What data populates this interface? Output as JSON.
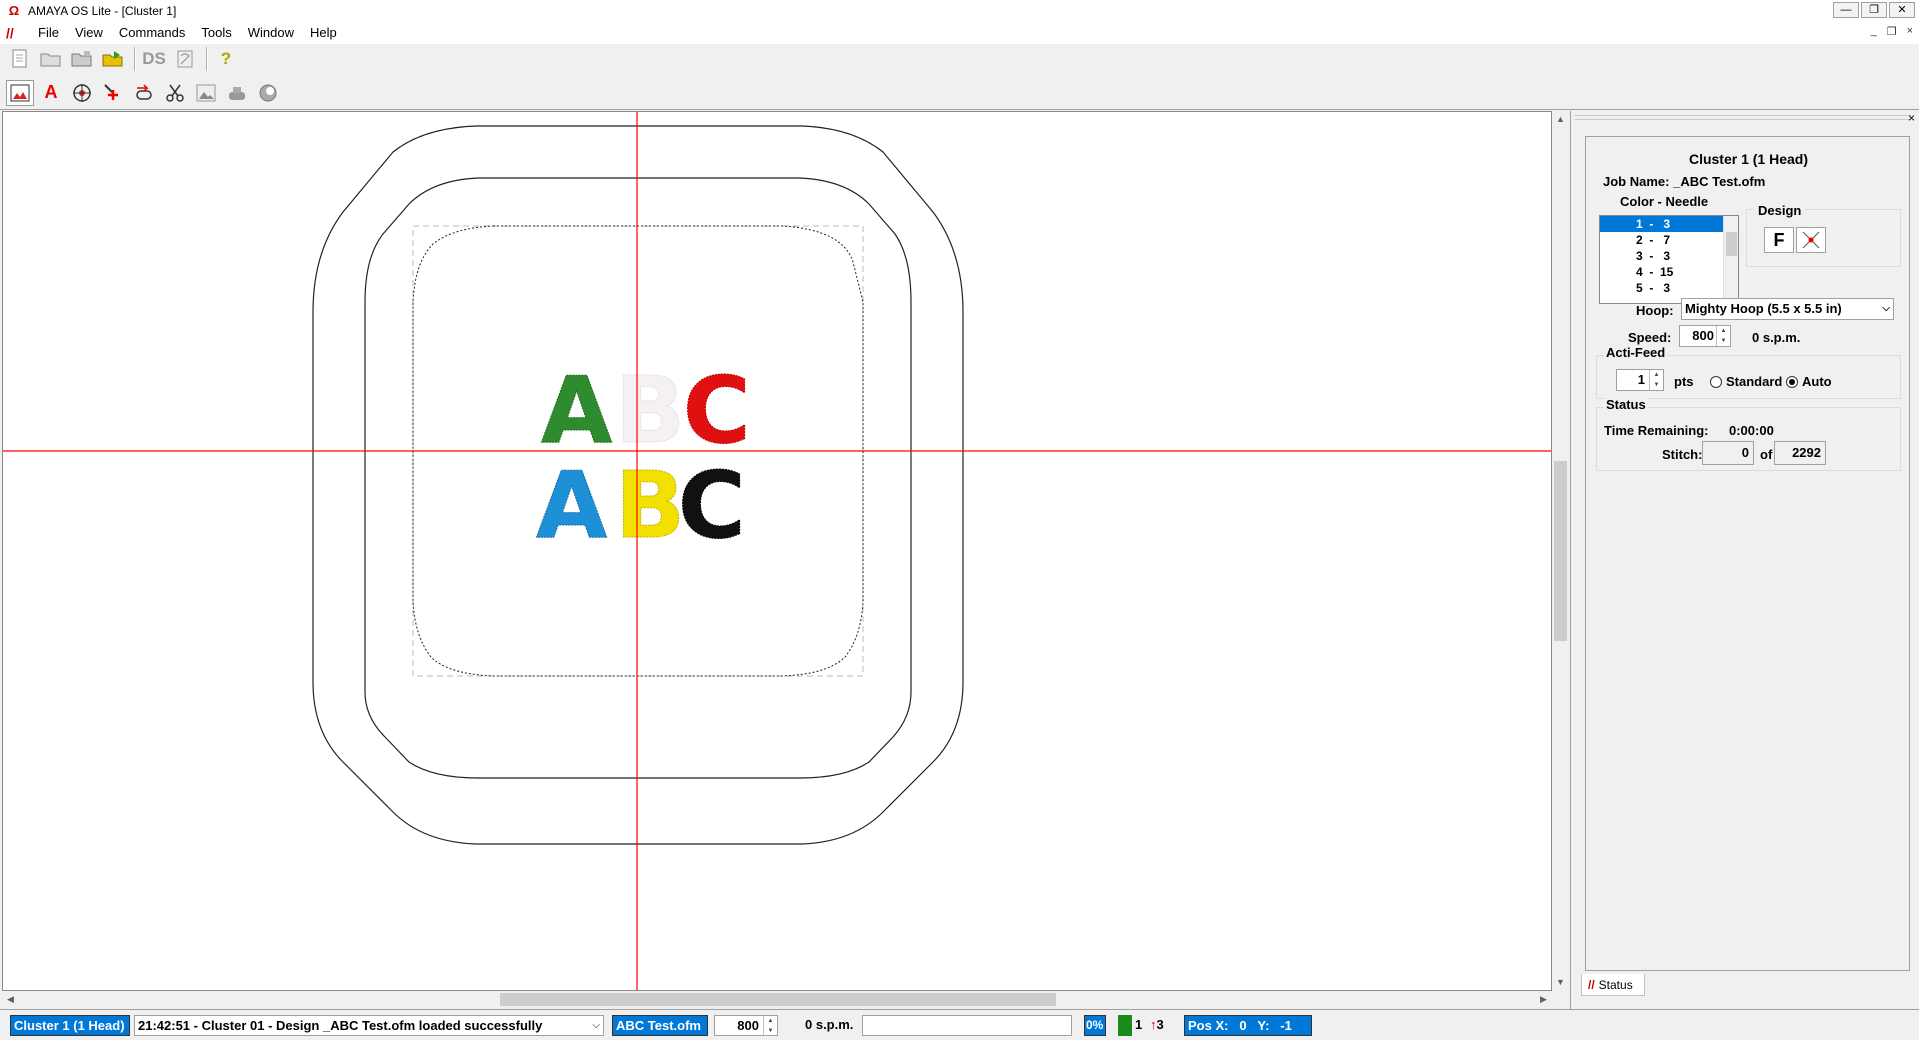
{
  "window": {
    "title": "AMAYA OS Lite - [Cluster 1]",
    "app_icon": "amaya-logo-icon",
    "controls": [
      "—",
      "❐",
      "✕"
    ],
    "mdi_controls": [
      "_",
      "❐",
      "×"
    ]
  },
  "menu": {
    "items": [
      "File",
      "View",
      "Commands",
      "Tools",
      "Window",
      "Help"
    ]
  },
  "toolbar1": {
    "icons": [
      "new-document-icon",
      "open-folder-icon",
      "open-folder-alt-icon",
      "import-folder-icon",
      "ds-icon",
      "scan-icon",
      "help-icon"
    ],
    "ds_label": "DS",
    "help_label": "?"
  },
  "toolbar2": {
    "icons": [
      "hoop-view-icon",
      "lettering-icon",
      "target-icon",
      "jump-icon",
      "trim-icon",
      "scissors-icon",
      "image-icon",
      "machine-icon",
      "palette-icon"
    ],
    "lettering_label": "A"
  },
  "canvas": {
    "design_rows": [
      {
        "letters": [
          "A",
          "B",
          "C"
        ],
        "colors": [
          "#2e8b2e",
          "#f4f0f4",
          "#e01010"
        ]
      },
      {
        "letters": [
          "A",
          "B",
          "C"
        ],
        "colors": [
          "#1e90d8",
          "#f2e000",
          "#111111"
        ]
      }
    ],
    "crosshair_color": "#ff0000"
  },
  "side_panel": {
    "title": "Cluster 1 (1 Head)",
    "job_name_label": "Job Name:",
    "job_name": "_ABC Test.ofm",
    "color_needle_label": "Color - Needle",
    "color_list": [
      {
        "text": "1  -   3",
        "selected": true
      },
      {
        "text": "2  -   7",
        "selected": false
      },
      {
        "text": "3  -   3",
        "selected": false
      },
      {
        "text": "4  -  15",
        "selected": false
      },
      {
        "text": "5  -   3",
        "selected": false
      }
    ],
    "design_label": "Design",
    "design_f_label": "F",
    "hoop_label": "Hoop:",
    "hoop_value": "Mighty Hoop (5.5 x 5.5 in)",
    "speed_label": "Speed:",
    "speed_value": "800",
    "speed_spm": "0 s.p.m.",
    "actifeed_label": "Acti-Feed",
    "actifeed_value": "1",
    "actifeed_unit": "pts",
    "radio_standard": "Standard",
    "radio_auto": "Auto",
    "radio_selected": "Auto",
    "status_label": "Status",
    "time_remaining_label": "Time Remaining:",
    "time_remaining": "0:00:00",
    "stitch_label": "Stitch:",
    "stitch_current": "0",
    "stitch_of_label": "of",
    "stitch_total": "2292",
    "tab_label": "Status"
  },
  "status_bar": {
    "cluster": "Cluster 1 (1 Head)",
    "message": "21:42:51 - Cluster 01 - Design _ABC Test.ofm loaded successfully",
    "design": "ABC Test.ofm",
    "speed": "800",
    "spm": "0 s.p.m.",
    "percent": "0%",
    "needle": "1",
    "trims": "3",
    "pos_x_label": "Pos X:",
    "pos_x": "0",
    "pos_y_label": "Y:",
    "pos_y": "-1",
    "needle_color": "#1a8a1a"
  }
}
